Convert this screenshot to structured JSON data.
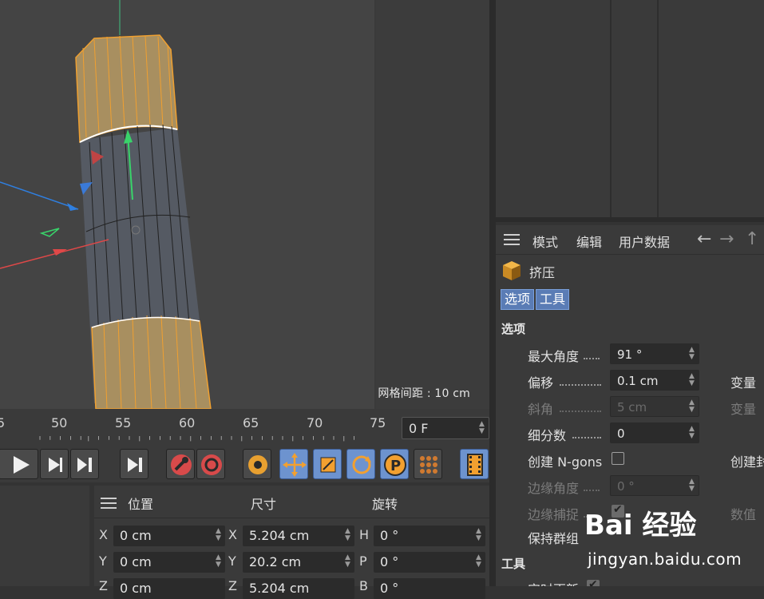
{
  "viewport": {
    "grid_label": "网格间距 : 10 cm"
  },
  "attributes": {
    "menu": [
      "模式",
      "编辑",
      "用户数据"
    ],
    "object_name": "挤压",
    "tabs": [
      "选项",
      "工具"
    ],
    "section_options": "选项",
    "section_tools": "工具",
    "rows": [
      {
        "label": "最大角度",
        "value": "91 °",
        "right_label": "",
        "dim": false
      },
      {
        "label": "偏移",
        "value": "0.1 cm",
        "right_label": "变量",
        "dim": false
      },
      {
        "label": "斜角",
        "value": "5 cm",
        "right_label": "变量",
        "dim": true
      },
      {
        "label": "细分数",
        "value": "0",
        "right_label": "",
        "dim": false
      },
      {
        "label": "创建 N-gons",
        "value": "",
        "right_label": "创建封",
        "dim": false
      },
      {
        "label": "边缘角度",
        "value": "0 °",
        "right_label": "",
        "dim": true
      },
      {
        "label": "边缘捕捉",
        "value": "",
        "right_label": "数值",
        "dim": true
      },
      {
        "label": "保持群组",
        "value": "",
        "right_label": "",
        "dim": false
      },
      {
        "label": "实时更新",
        "value": "",
        "right_label": "",
        "dim": false
      }
    ]
  },
  "timeline": {
    "ticks": [
      "5",
      "50",
      "55",
      "60",
      "65",
      "70",
      "75"
    ],
    "current_frame": "0 F"
  },
  "coordinates": {
    "headers": [
      "位置",
      "尺寸",
      "旋转"
    ],
    "position": [
      {
        "axis": "X",
        "value": "0 cm"
      },
      {
        "axis": "Y",
        "value": "0 cm"
      },
      {
        "axis": "Z",
        "value": "0 cm"
      }
    ],
    "size": [
      {
        "axis": "X",
        "value": "5.204 cm"
      },
      {
        "axis": "Y",
        "value": "20.2 cm"
      },
      {
        "axis": "Z",
        "value": "5.204 cm"
      }
    ],
    "rotation": [
      {
        "axis": "H",
        "value": "0 °"
      },
      {
        "axis": "P",
        "value": "0 °"
      },
      {
        "axis": "B",
        "value": "0 °"
      }
    ]
  },
  "watermark": {
    "logo": "Bai 经验",
    "url": "jingyan.baidu.com"
  },
  "colors": {
    "accent_blue": "#6d93cf",
    "selection_orange": "#f0a030"
  }
}
